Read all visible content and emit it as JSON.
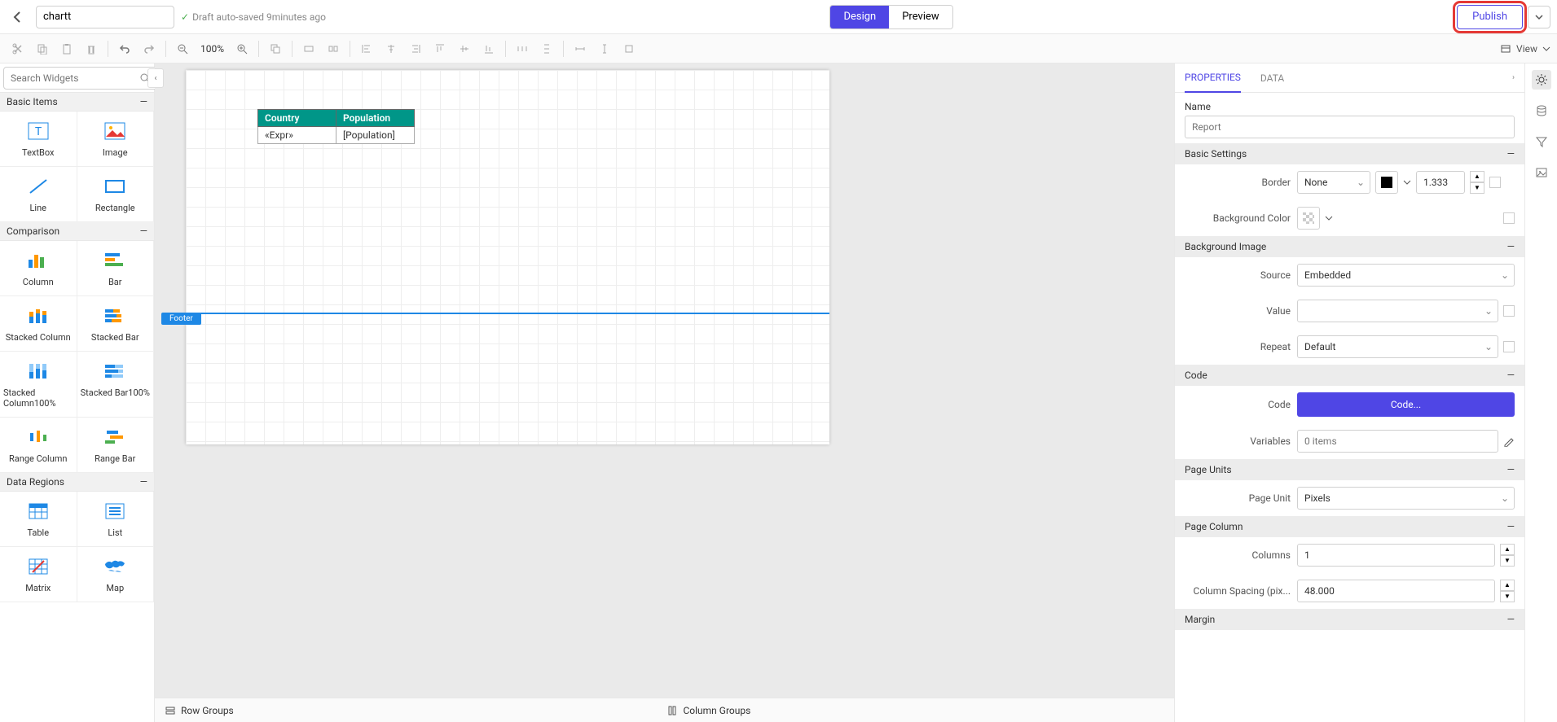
{
  "header": {
    "title": "chartt",
    "save_status": "Draft auto-saved 9minutes ago",
    "design": "Design",
    "preview": "Preview",
    "publish": "Publish"
  },
  "toolbar": {
    "zoom": "100%",
    "view": "View"
  },
  "widgets": {
    "search_placeholder": "Search Widgets",
    "groups": [
      {
        "name": "Basic Items",
        "items": [
          "TextBox",
          "Image",
          "Line",
          "Rectangle"
        ]
      },
      {
        "name": "Comparison",
        "items": [
          "Column",
          "Bar",
          "Stacked Column",
          "Stacked Bar",
          "Stacked Column100%",
          "Stacked Bar100%",
          "Range Column",
          "Range Bar"
        ]
      },
      {
        "name": "Data Regions",
        "items": [
          "Table",
          "List",
          "Matrix",
          "Map"
        ]
      }
    ]
  },
  "canvas": {
    "footer_label": "Footer",
    "table": {
      "headers": [
        "Country",
        "Population"
      ],
      "row": [
        "«Expr»",
        "[Population]"
      ]
    }
  },
  "groups_bar": {
    "row": "Row Groups",
    "col": "Column Groups"
  },
  "props": {
    "tabs": {
      "properties": "PROPERTIES",
      "data": "DATA"
    },
    "name_label": "Name",
    "name_placeholder": "Report",
    "sections": {
      "basic": "Basic Settings",
      "bgimg": "Background Image",
      "code": "Code",
      "units": "Page Units",
      "column": "Page Column",
      "margin": "Margin"
    },
    "labels": {
      "border": "Border",
      "bgcolor": "Background Color",
      "source": "Source",
      "value": "Value",
      "repeat": "Repeat",
      "code": "Code",
      "variables": "Variables",
      "pageunit": "Page Unit",
      "columns": "Columns",
      "colspacing": "Column Spacing (pix..."
    },
    "values": {
      "border_style": "None",
      "border_width": "1.333",
      "source": "Embedded",
      "repeat": "Default",
      "code_btn": "Code...",
      "variables_placeholder": "0 items",
      "pageunit": "Pixels",
      "columns": "1",
      "colspacing": "48.000"
    }
  }
}
